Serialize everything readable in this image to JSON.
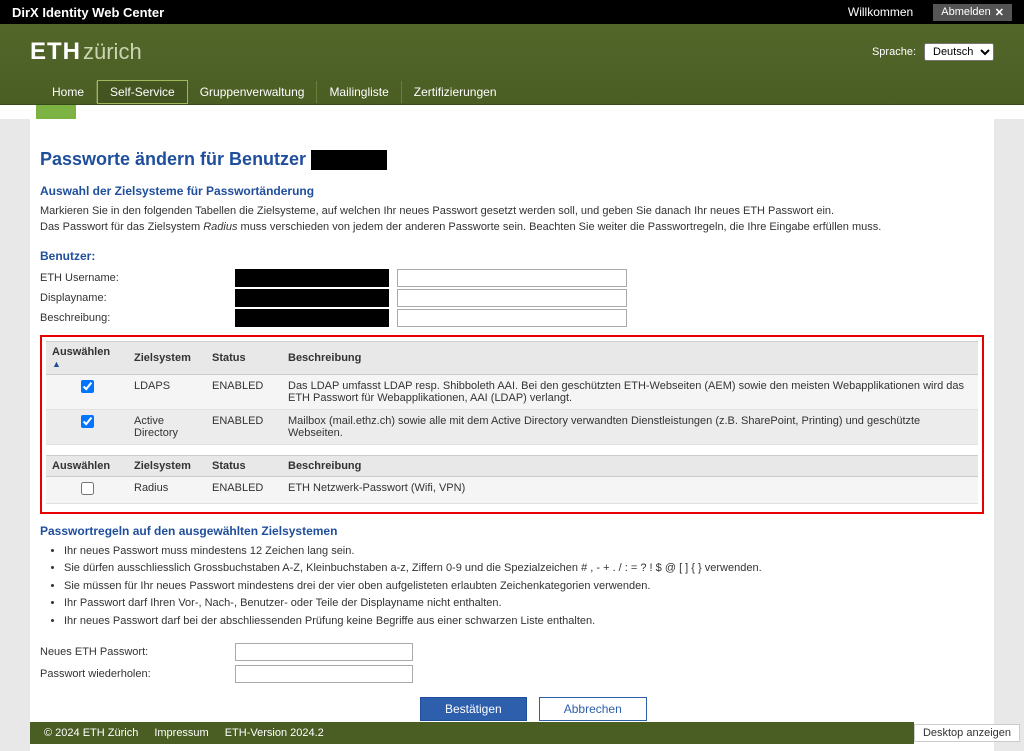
{
  "topbar": {
    "title": "DirX Identity Web Center",
    "welcome": "Willkommen",
    "logout": "Abmelden"
  },
  "header": {
    "logo_bold": "ETH",
    "logo_light": "zürich",
    "language_label": "Sprache:",
    "language_options": [
      "Deutsch"
    ],
    "language_selected": "Deutsch"
  },
  "nav": {
    "items": [
      "Home",
      "Self-Service",
      "Gruppenverwaltung",
      "Mailingliste",
      "Zertifizierungen"
    ],
    "active_index": 1
  },
  "page": {
    "title_prefix": "Passworte ändern für Benutzer ",
    "section1_title": "Auswahl der Zielsysteme für Passwortänderung",
    "intro_line1": "Markieren Sie in den folgenden Tabellen die Zielsysteme, auf welchen Ihr neues Passwort gesetzt werden soll, und geben Sie danach Ihr neues ETH Passwort ein.",
    "intro_line2_a": "Das Passwort für das Zielsystem ",
    "intro_line2_em": "Radius",
    "intro_line2_b": " muss verschieden von jedem der anderen Passworte sein. Beachten Sie weiter die Passwortregeln, die Ihre Eingabe erfüllen muss.",
    "user_heading": "Benutzer:",
    "fields": {
      "username_label": "ETH Username:",
      "displayname_label": "Displayname:",
      "desc_label": "Beschreibung:"
    }
  },
  "table": {
    "headers": {
      "select": "Auswählen",
      "system": "Zielsystem",
      "status": "Status",
      "desc": "Beschreibung"
    },
    "group1": [
      {
        "checked": true,
        "system": "LDAPS",
        "status": "ENABLED",
        "desc": "Das LDAP umfasst LDAP resp. Shibboleth AAI. Bei den geschützten ETH-Webseiten (AEM) sowie den meisten Webapplikationen wird das ETH Passwort für Webapplikationen, AAI (LDAP) verlangt."
      },
      {
        "checked": true,
        "system": "Active Directory",
        "status": "ENABLED",
        "desc": "Mailbox (mail.ethz.ch) sowie alle mit dem Active Directory verwandten Dienstleistungen (z.B. SharePoint, Printing) und geschützte Webseiten."
      }
    ],
    "group2": [
      {
        "checked": false,
        "system": "Radius",
        "status": "ENABLED",
        "desc": "ETH Netzwerk-Passwort (Wifi, VPN)"
      }
    ]
  },
  "rules": {
    "title": "Passwortregeln auf den ausgewählten Zielsystemen",
    "items": [
      "Ihr neues Passwort muss mindestens 12 Zeichen lang sein.",
      "Sie dürfen ausschliesslich Grossbuchstaben A-Z, Kleinbuchstaben a-z, Ziffern 0-9 und die Spezialzeichen # , - + . / : = ? ! $ @ [ ] { } verwenden.",
      "Sie müssen für Ihr neues Passwort mindestens drei der vier oben aufgelisteten erlaubten Zeichenkategorien verwenden.",
      "Ihr Passwort darf Ihren Vor-, Nach-, Benutzer- oder Teile der Displayname nicht enthalten.",
      "Ihr neues Passwort darf bei der abschliessenden Prüfung keine Begriffe aus einer schwarzen Liste enthalten."
    ]
  },
  "password_form": {
    "new_label": "Neues ETH Passwort:",
    "repeat_label": "Passwort wiederholen:",
    "confirm": "Bestätigen",
    "cancel": "Abbrechen"
  },
  "footer": {
    "copyright": "© 2024 ETH Zürich",
    "impressum": "Impressum",
    "version": "ETH-Version 2024.2",
    "desktop": "Desktop anzeigen"
  }
}
